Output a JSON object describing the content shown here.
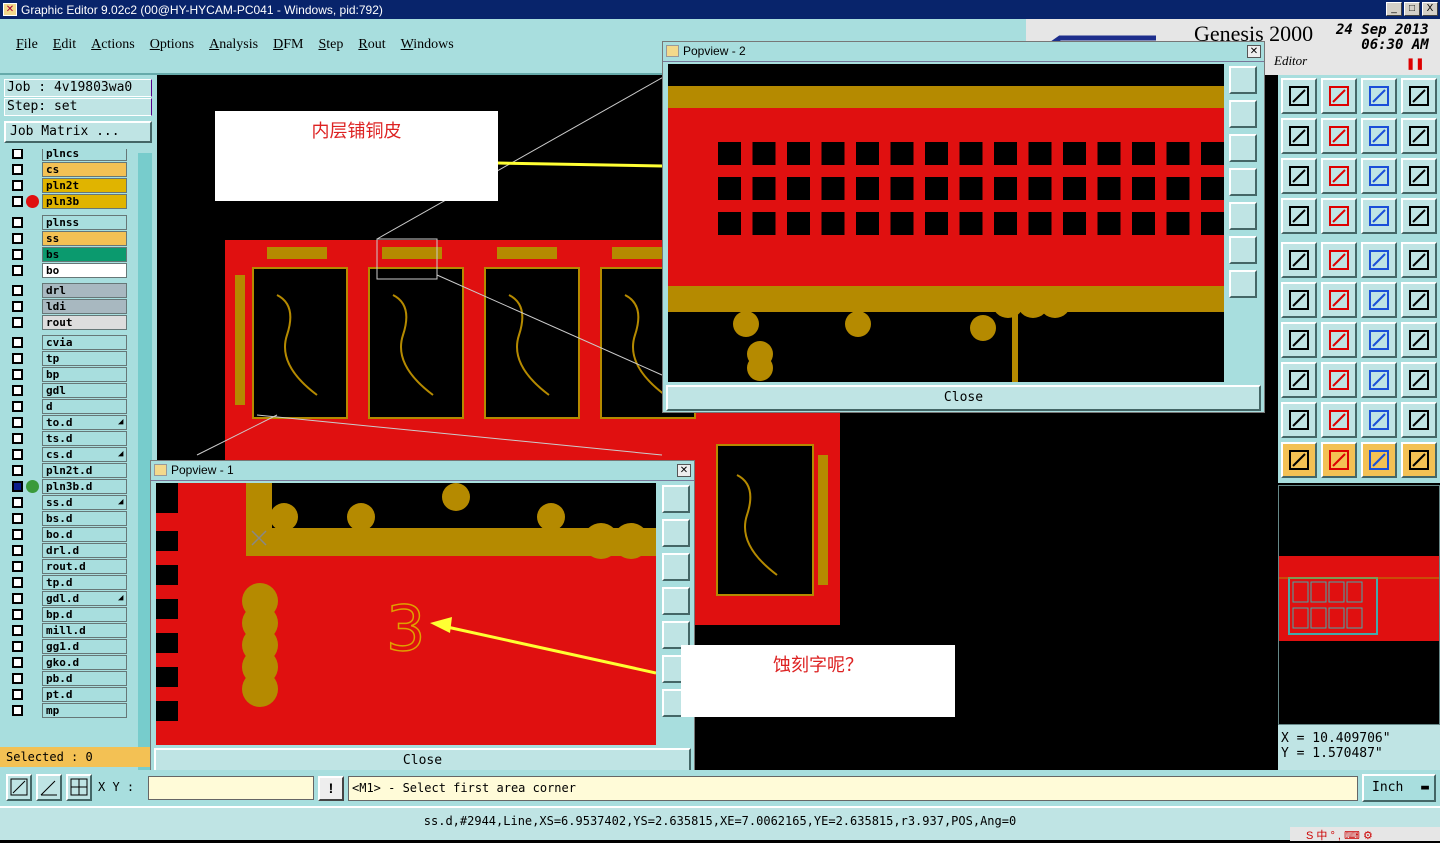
{
  "window": {
    "title": "Graphic Editor 9.02c2 (00@HY-HYCAM-PC041 - Windows, pid:792)",
    "controls": [
      "_",
      "□",
      "X"
    ]
  },
  "menu": {
    "items": [
      "File",
      "Edit",
      "Actions",
      "Options",
      "Analysis",
      "DFM",
      "Step",
      "Rout",
      "Windows"
    ]
  },
  "brand": {
    "product": "Genesis 2000",
    "date": "24 Sep 2013",
    "time": "06:30 AM",
    "subtitle": "Editor"
  },
  "job": {
    "job_label": "Job : 4v19803wa0",
    "step_label": "Step: set",
    "matrix_button": "Job Matrix ..."
  },
  "layers": [
    {
      "name": "plncs",
      "color": "#a8dede"
    },
    {
      "name": "cs",
      "color": "#f3c154"
    },
    {
      "name": "pln2t",
      "color": "#e0b400"
    },
    {
      "name": "pln3b",
      "color": "#e0b400",
      "dot": "#e01010"
    },
    {
      "name": "plnss",
      "color": "#a8dede"
    },
    {
      "name": "ss",
      "color": "#f3c154"
    },
    {
      "name": "bs",
      "color": "#0b9a6e"
    },
    {
      "name": "bo",
      "color": "#ffffff"
    },
    {
      "name": "drl",
      "color": "#a8b8c0"
    },
    {
      "name": "ldi",
      "color": "#a8b8c0"
    },
    {
      "name": "rout",
      "color": "#dddddd"
    },
    {
      "name": "cvia",
      "color": "#a8dede"
    },
    {
      "name": "tp",
      "color": "#a8dede"
    },
    {
      "name": "bp",
      "color": "#a8dede"
    },
    {
      "name": "gdl",
      "color": "#a8dede"
    },
    {
      "name": "d",
      "color": "#a8dede"
    },
    {
      "name": "to.d",
      "color": "#a8dede",
      "badge": true
    },
    {
      "name": "ts.d",
      "color": "#a8dede"
    },
    {
      "name": "cs.d",
      "color": "#a8dede",
      "badge": true
    },
    {
      "name": "pln2t.d",
      "color": "#a8dede"
    },
    {
      "name": "pln3b.d",
      "color": "#a8dede",
      "dot": "#3a9a3a"
    },
    {
      "name": "ss.d",
      "color": "#a8dede",
      "badge": true
    },
    {
      "name": "bs.d",
      "color": "#a8dede"
    },
    {
      "name": "bo.d",
      "color": "#a8dede"
    },
    {
      "name": "drl.d",
      "color": "#a8dede"
    },
    {
      "name": "rout.d",
      "color": "#a8dede"
    },
    {
      "name": "tp.d",
      "color": "#a8dede"
    },
    {
      "name": "gdl.d",
      "color": "#a8dede",
      "badge": true
    },
    {
      "name": "bp.d",
      "color": "#a8dede"
    },
    {
      "name": "mill.d",
      "color": "#a8dede"
    },
    {
      "name": "gg1.d",
      "color": "#a8dede"
    },
    {
      "name": "gko.d",
      "color": "#a8dede"
    },
    {
      "name": "pb.d",
      "color": "#a8dede"
    },
    {
      "name": "pt.d",
      "color": "#a8dede"
    },
    {
      "name": "mp",
      "color": "#a8dede"
    }
  ],
  "selected": "Selected : 0",
  "command": {
    "xy_label": "X Y :",
    "xy_value": "",
    "prompt": "<M1> - Select first area corner",
    "units": "Inch"
  },
  "status": "ss.d,#2944,Line,XS=6.9537402,YS=2.635815,XE=7.0062165,YE=2.635815,r3.937,POS,Ang=0",
  "coords": {
    "x": "X = 10.409706\"",
    "y": "Y = 1.570487\""
  },
  "tray": "S 中 ° , ⌨ ⚙",
  "popview1": {
    "title": "Popview - 1",
    "close": "Close"
  },
  "popview2": {
    "title": "Popview - 2",
    "close": "Close"
  },
  "callouts": {
    "top": "内层铺铜皮",
    "bottom": "蚀刻字呢？"
  },
  "colors": {
    "panel": "#a8dede",
    "copper": "#e01010",
    "pad": "#b58a00",
    "accent": "#f3c154"
  },
  "icons": {
    "right_toolbar": [
      "zoom-home-icon",
      "zoom-prev-icon",
      "zoom-house-icon",
      "zoom-window-icon",
      "pan-left-icon",
      "pan-right-icon",
      "rotate-view-icon",
      "mirror-view-icon",
      "fit-screen-icon",
      "zoom-center-icon",
      "scale-1to2-icon",
      "help-icon",
      "measure-icon",
      "grid-icon",
      "layer-select-icon",
      "layer-select-alt-icon",
      "snap-icon",
      "ruler-line-icon",
      "ruler-icon",
      "pad-icon",
      "route-nodes-icon",
      "cross-icon",
      "move-point-icon",
      "copy-point-icon",
      "line-angle-icon",
      "line-draw-icon",
      "arc-icon",
      "flip-icon",
      "clear-icon",
      "dimension-icon",
      "box-dim-icon",
      "group-icon",
      "triangle-a-icon",
      "triangle-b-icon",
      "triangle-c-icon",
      "triangle-d-icon",
      "select-arrow-icon",
      "select-box-icon",
      "select-area-icon",
      "select-net-icon"
    ]
  }
}
